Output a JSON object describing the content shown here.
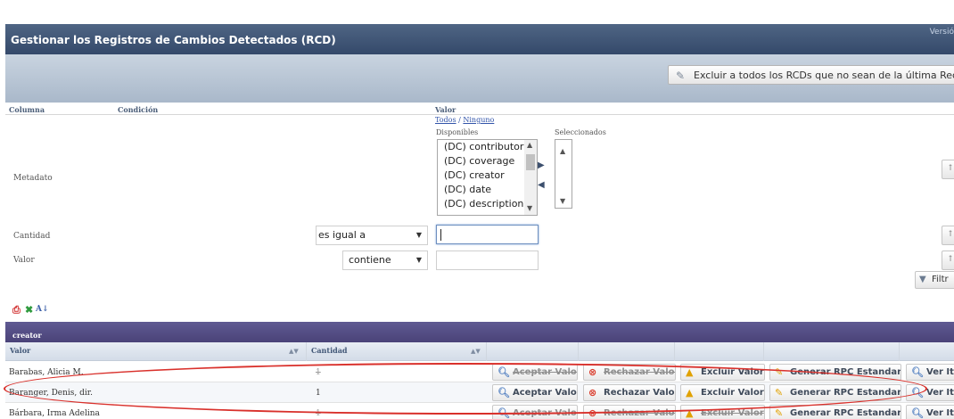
{
  "header": {
    "title": "Gestionar los Registros de Cambios Detectados (RCD)",
    "version": "Versió"
  },
  "toolbar": {
    "exclude_label": "Excluir a todos los RCDs que no sean de la última Recolecci"
  },
  "filter": {
    "columns": [
      "Columna",
      "Condición",
      "Valor"
    ],
    "todos": "Todos",
    "separator": "/",
    "ninguno": "Ninguno",
    "disponibles": "Disponibles",
    "seleccionados": "Seleccionados",
    "options": [
      "(DC) contributor",
      "(DC) coverage",
      "(DC) creator",
      "(DC) date",
      "(DC) description"
    ],
    "rows": [
      {
        "label": "Metadato"
      },
      {
        "label": "Cantidad",
        "condition": "es igual a",
        "value": ""
      },
      {
        "label": "Valor",
        "condition": "contiene",
        "value": ""
      }
    ],
    "filter_button": "Filtr"
  },
  "grid": {
    "caption": "creator",
    "headers": [
      "Valor",
      "Cantidad"
    ],
    "actions": [
      "Aceptar Valor",
      "Rechazar Valor",
      "Excluir Valor",
      "Generar RPC Estandar",
      "Ver Iter"
    ],
    "rows": [
      {
        "valor": "Barabas, Alicia M.",
        "cantidad": "1",
        "struck": true
      },
      {
        "valor": "Baranger, Denis, dir.",
        "cantidad": "1",
        "struck": false
      },
      {
        "valor": "Bárbara, Irma Adelina",
        "cantidad": "1",
        "struck": true
      }
    ]
  },
  "colors": {
    "titlebar": "#34496a",
    "caption": "#4a4378",
    "highlight": "#d9302b"
  }
}
